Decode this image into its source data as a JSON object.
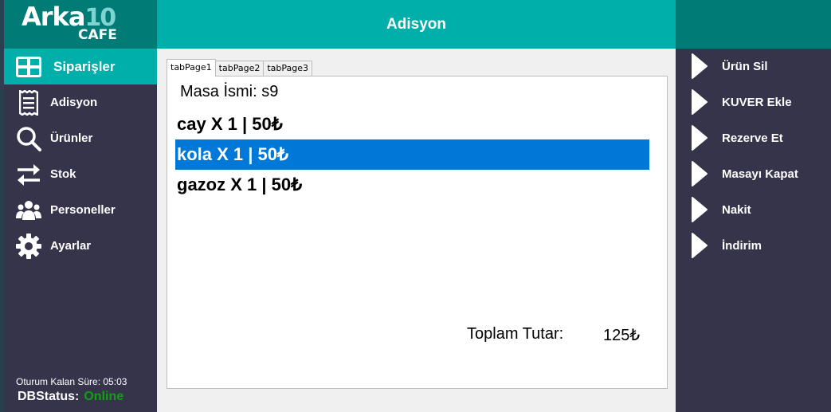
{
  "app": {
    "logo_main": "Arka",
    "logo_num": "10",
    "logo_sub": "CAFE",
    "header_title": "Adisyon"
  },
  "sidebar": {
    "items": [
      {
        "label": "Siparişler",
        "icon": "grid-icon",
        "active": true
      },
      {
        "label": "Adisyon",
        "icon": "receipt-icon",
        "active": false
      },
      {
        "label": "Ürünler",
        "icon": "search-icon",
        "active": false
      },
      {
        "label": "Stok",
        "icon": "swap-arrows-icon",
        "active": false
      },
      {
        "label": "Personeller",
        "icon": "people-icon",
        "active": false
      },
      {
        "label": "Ayarlar",
        "icon": "gear-icon",
        "active": false
      }
    ],
    "session_time": "Oturum Kalan Süre: 05:03",
    "db_status_label": "DBStatus:",
    "db_status_value": "Online"
  },
  "tabs": [
    {
      "label": "tabPage1",
      "active": true
    },
    {
      "label": "tabPage2",
      "active": false
    },
    {
      "label": "tabPage3",
      "active": false
    }
  ],
  "order": {
    "table_name": "Masa İsmi: s9",
    "items": [
      {
        "text": "cay X 1 | 50₺",
        "selected": false
      },
      {
        "text": "kola X 1 | 50₺",
        "selected": true
      },
      {
        "text": "gazoz X 1 | 50₺",
        "selected": false
      }
    ],
    "total_label": "Toplam Tutar:",
    "total_value": "125₺"
  },
  "actions": [
    {
      "label": "Ürün Sil"
    },
    {
      "label": "KUVER Ekle"
    },
    {
      "label": "Rezerve Et"
    },
    {
      "label": "Masayı Kapat"
    },
    {
      "label": "Nakit"
    },
    {
      "label": "İndirim"
    }
  ],
  "colors": {
    "accent": "#00afa9",
    "accent_dark": "#007b76",
    "sidebar_bg": "#36344b",
    "selection": "#0078d7",
    "online": "#10a010"
  }
}
